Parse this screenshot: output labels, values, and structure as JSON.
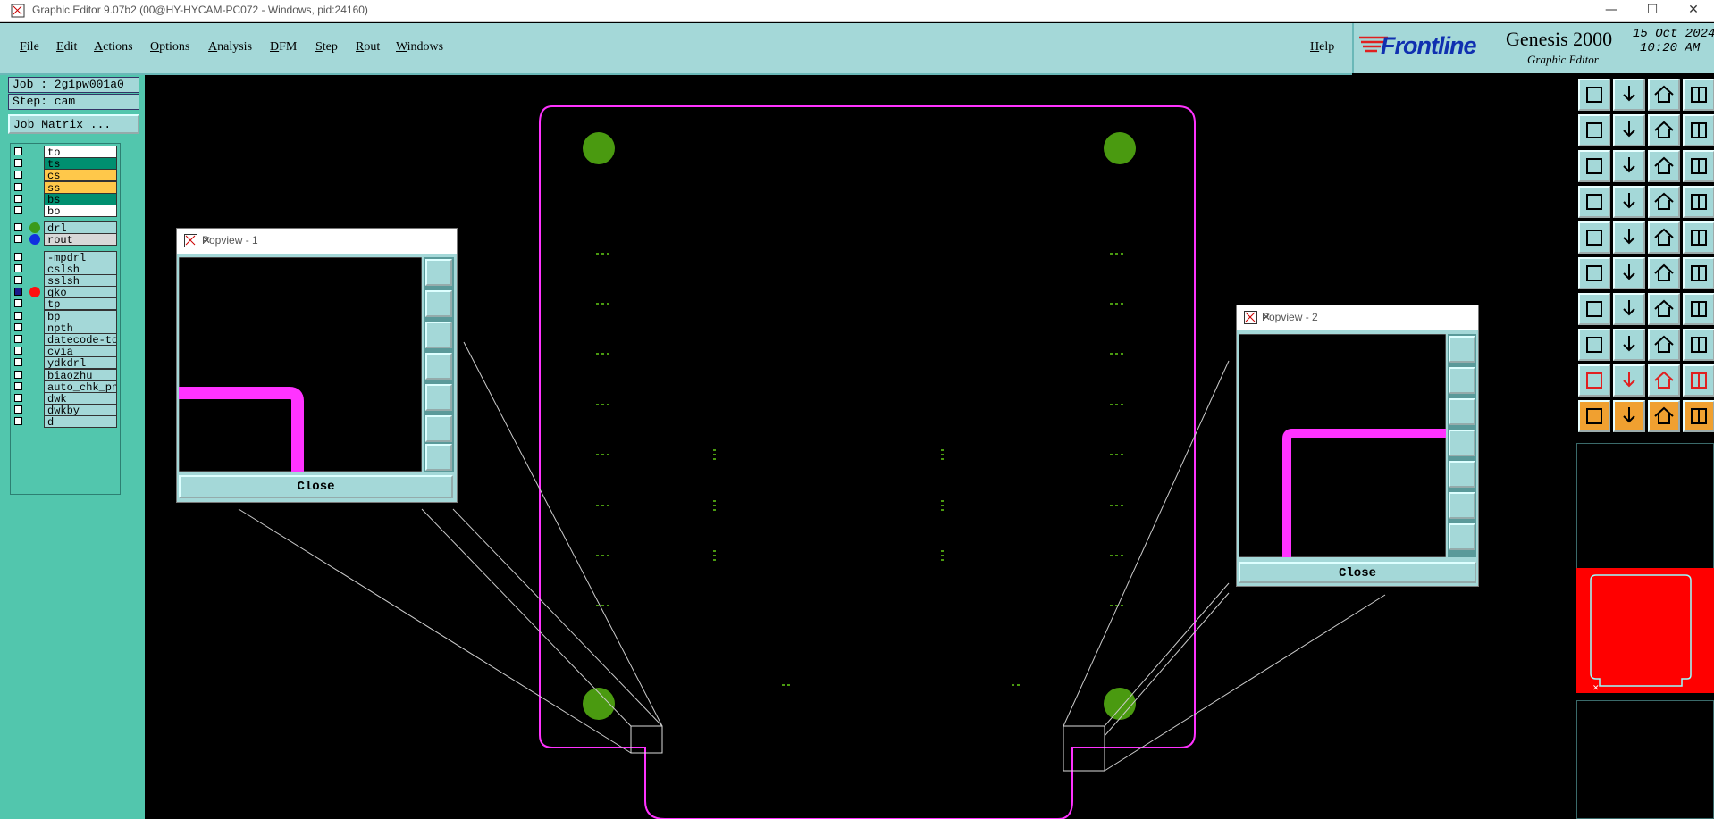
{
  "window": {
    "title": "Graphic Editor 9.07b2 (00@HY-HYCAM-PC072 - Windows, pid:24160)",
    "controls": [
      "—",
      "☐",
      "✕"
    ]
  },
  "menu": {
    "items": [
      "File",
      "Edit",
      "Actions",
      "Options",
      "Analysis",
      "DFM",
      "Step",
      "Rout",
      "Windows"
    ],
    "help": "Help"
  },
  "brand": {
    "logo": "Frontline",
    "product": "Genesis 2000",
    "subtitle": "Graphic Editor",
    "date": "15 Oct 2024",
    "time": "10:20 AM"
  },
  "job": {
    "job_label": "Job : 2g1pw001a0",
    "step_label": "Step: cam",
    "matrix_button": "Job Matrix ..."
  },
  "layers": [
    {
      "name": "to",
      "color": "#ffffff",
      "dot": ""
    },
    {
      "name": "ts",
      "color": "#008f70",
      "dot": ""
    },
    {
      "name": "cs",
      "color": "#ffc84a",
      "dot": ""
    },
    {
      "name": "ss",
      "color": "#ffc84a",
      "dot": ""
    },
    {
      "name": "bs",
      "color": "#008f70",
      "dot": ""
    },
    {
      "name": "bo",
      "color": "#ffffff",
      "dot": ""
    },
    {
      "name": "drl",
      "color": "#a4d8d8",
      "dot": "#3a9a1a"
    },
    {
      "name": "rout",
      "color": "#d8d8d8",
      "dot": "#1030e0"
    },
    {
      "name": "-mpdrl",
      "color": "#a4d8d8",
      "dot": ""
    },
    {
      "name": "cslsh",
      "color": "#a4d8d8",
      "dot": ""
    },
    {
      "name": "sslsh",
      "color": "#a4d8d8",
      "dot": ""
    },
    {
      "name": "gko",
      "color": "#a4d8d8",
      "dot": "#ff1010"
    },
    {
      "name": "tp",
      "color": "#a4d8d8",
      "dot": ""
    },
    {
      "name": "bp",
      "color": "#a4d8d8",
      "dot": ""
    },
    {
      "name": "npth",
      "color": "#a4d8d8",
      "dot": ""
    },
    {
      "name": "datecode-to",
      "color": "#a4d8d8",
      "dot": ""
    },
    {
      "name": "cvia",
      "color": "#a4d8d8",
      "dot": ""
    },
    {
      "name": "ydkdrl",
      "color": "#a4d8d8",
      "dot": ""
    },
    {
      "name": "biaozhu",
      "color": "#a4d8d8",
      "dot": ""
    },
    {
      "name": "auto_chk_pn",
      "color": "#a4d8d8",
      "dot": ""
    },
    {
      "name": "dwk",
      "color": "#a4d8d8",
      "dot": ""
    },
    {
      "name": "dwkby",
      "color": "#a4d8d8",
      "dot": ""
    },
    {
      "name": "d",
      "color": "#a4d8d8",
      "dot": ""
    }
  ],
  "popview1": {
    "title": "Popview - 1",
    "close_label": "Close"
  },
  "popview2": {
    "title": "Popview - 2",
    "close_label": "Close"
  },
  "colors": {
    "profile": "#ff33ff",
    "pads": "#4a9a10",
    "board_preview": "#ff0000"
  }
}
